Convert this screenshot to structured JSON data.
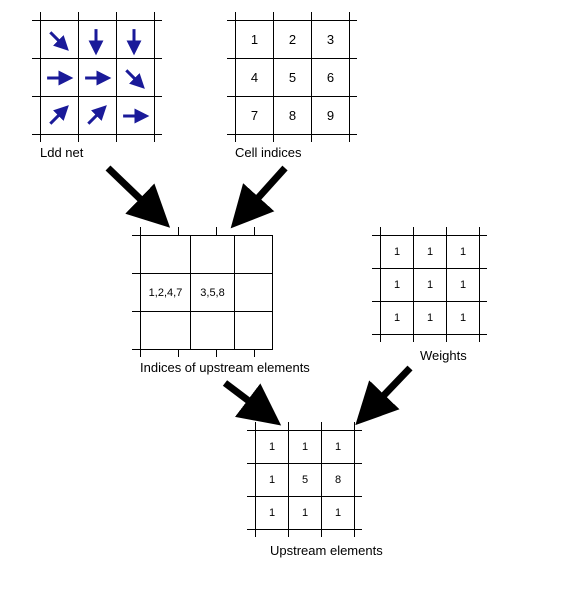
{
  "captions": {
    "ldd": "Ldd net",
    "indices": "Cell indices",
    "upstream_idx": "Indices of upstream elements",
    "weights": "Weights",
    "upstream_el": "Upstream elements"
  },
  "ldd_directions": [
    [
      "se",
      "s",
      "s"
    ],
    [
      "e",
      "e",
      "se"
    ],
    [
      "ne",
      "ne",
      "e"
    ]
  ],
  "cell_indices": [
    [
      "1",
      "2",
      "3"
    ],
    [
      "4",
      "5",
      "6"
    ],
    [
      "7",
      "8",
      "9"
    ]
  ],
  "upstream_indices": [
    [
      "",
      "",
      ""
    ],
    [
      "1,2,4,7",
      "3,5,8",
      ""
    ],
    [
      "",
      "",
      ""
    ]
  ],
  "weights": [
    [
      "1",
      "1",
      "1"
    ],
    [
      "1",
      "1",
      "1"
    ],
    [
      "1",
      "1",
      "1"
    ]
  ],
  "upstream_elements": [
    [
      "1",
      "1",
      "1"
    ],
    [
      "1",
      "5",
      "8"
    ],
    [
      "1",
      "1",
      "1"
    ]
  ],
  "colors": {
    "ldd_arrow": "#1a1a99",
    "flow_arrow": "#000000"
  },
  "chart_data": {
    "type": "table",
    "title": "Computation of upstream elements from an LDD network",
    "grids": [
      {
        "name": "Ldd net",
        "rows": 3,
        "cols": 3,
        "content": "flow directions (arrows)",
        "directions": [
          [
            "SE",
            "S",
            "S"
          ],
          [
            "E",
            "E",
            "SE"
          ],
          [
            "NE",
            "NE",
            "E"
          ]
        ]
      },
      {
        "name": "Cell indices",
        "rows": 3,
        "cols": 3,
        "values": [
          [
            1,
            2,
            3
          ],
          [
            4,
            5,
            6
          ],
          [
            7,
            8,
            9
          ]
        ]
      },
      {
        "name": "Indices of upstream elements",
        "rows": 3,
        "cols": 3,
        "values": [
          [
            "",
            "",
            ""
          ],
          [
            "1,2,4,7",
            "3,5,8",
            ""
          ],
          [
            "",
            "",
            ""
          ]
        ]
      },
      {
        "name": "Weights",
        "rows": 3,
        "cols": 3,
        "values": [
          [
            1,
            1,
            1
          ],
          [
            1,
            1,
            1
          ],
          [
            1,
            1,
            1
          ]
        ]
      },
      {
        "name": "Upstream elements",
        "rows": 3,
        "cols": 3,
        "values": [
          [
            1,
            1,
            1
          ],
          [
            1,
            5,
            8
          ],
          [
            1,
            1,
            1
          ]
        ]
      }
    ],
    "flows": [
      {
        "from": "Ldd net",
        "to": "Indices of upstream elements"
      },
      {
        "from": "Cell indices",
        "to": "Indices of upstream elements"
      },
      {
        "from": "Indices of upstream elements",
        "to": "Upstream elements"
      },
      {
        "from": "Weights",
        "to": "Upstream elements"
      }
    ]
  }
}
